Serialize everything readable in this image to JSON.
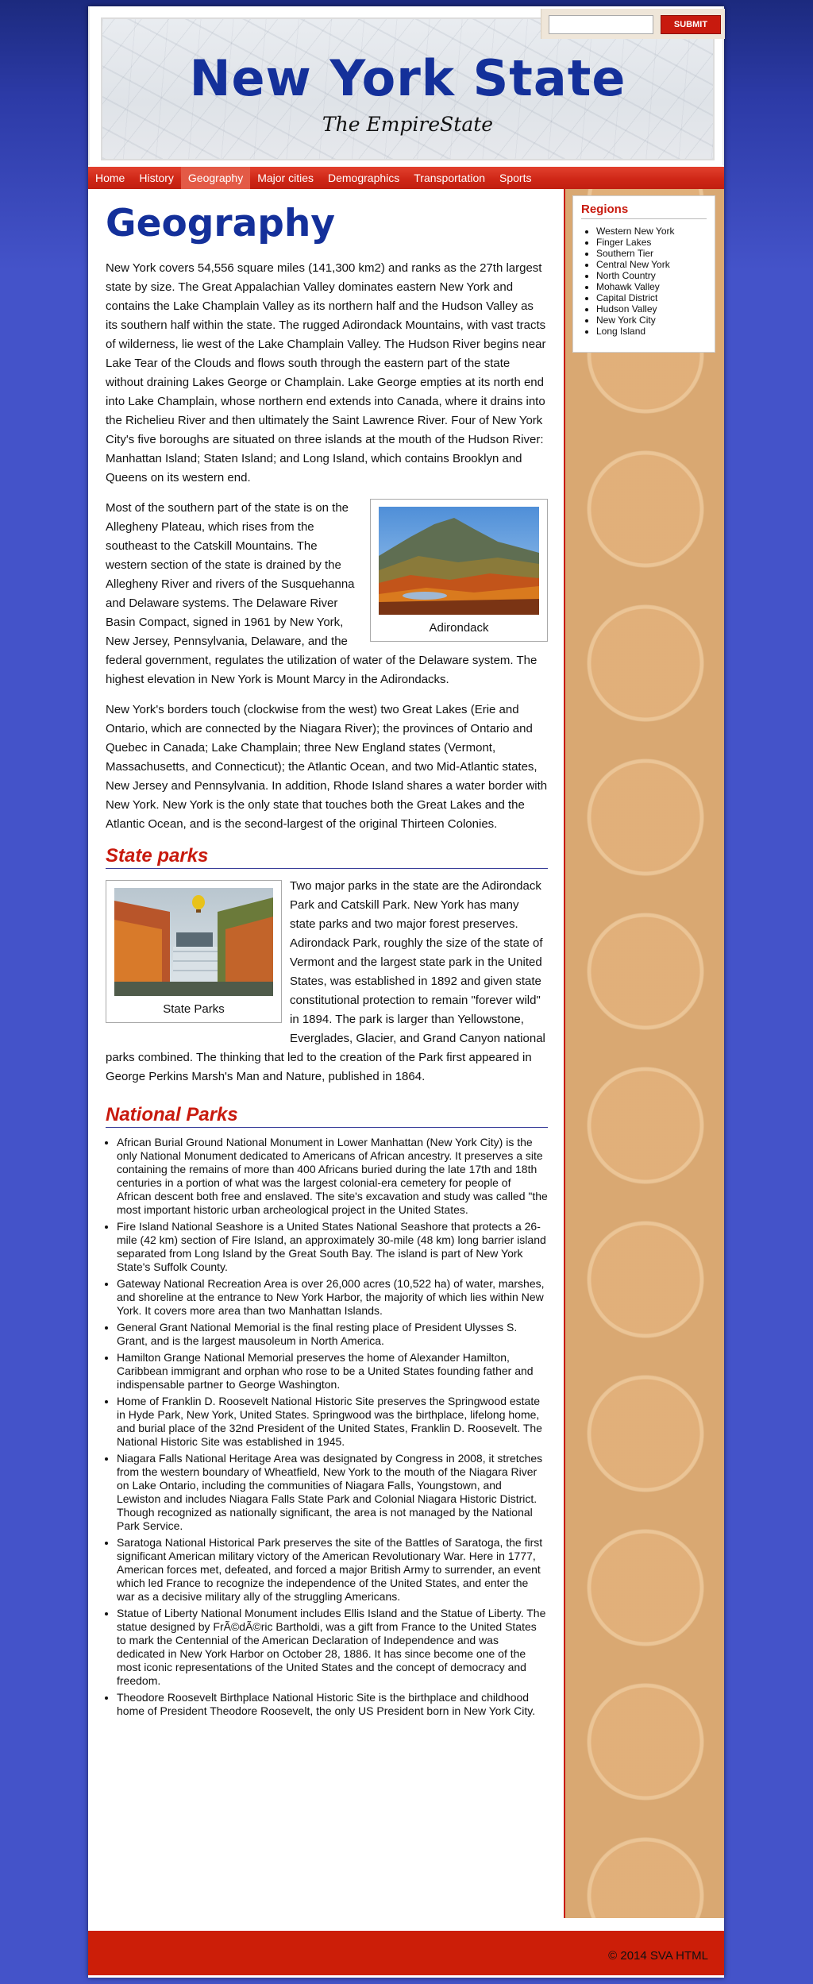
{
  "header": {
    "title": "New York State",
    "tagline": "The EmpireState",
    "search": {
      "value": "",
      "placeholder": "",
      "submit_label": "SUBMIT"
    }
  },
  "nav": {
    "items": [
      {
        "label": "Home"
      },
      {
        "label": "History"
      },
      {
        "label": "Geography"
      },
      {
        "label": "Major cities"
      },
      {
        "label": "Demographics"
      },
      {
        "label": "Transportation"
      },
      {
        "label": "Sports"
      }
    ],
    "active": "Geography"
  },
  "main": {
    "heading": "Geography",
    "paragraphs": [
      "New York covers 54,556 square miles (141,300 km2) and ranks as the 27th largest state by size. The Great Appalachian Valley dominates eastern New York and contains the Lake Champlain Valley as its northern half and the Hudson Valley as its southern half within the state. The rugged Adirondack Mountains, with vast tracts of wilderness, lie west of the Lake Champlain Valley. The Hudson River begins near Lake Tear of the Clouds and flows south through the eastern part of the state without draining Lakes George or Champlain. Lake George empties at its north end into Lake Champlain, whose northern end extends into Canada, where it drains into the Richelieu River and then ultimately the Saint Lawrence River. Four of New York City's five boroughs are situated on three islands at the mouth of the Hudson River: Manhattan Island; Staten Island; and Long Island, which contains Brooklyn and Queens on its western end.",
      "Most of the southern part of the state is on the Allegheny Plateau, which rises from the southeast to the Catskill Mountains. The western section of the state is drained by the Allegheny River and rivers of the Susquehanna and Delaware systems. The Delaware River Basin Compact, signed in 1961 by New York, New Jersey, Pennsylvania, Delaware, and the federal government, regulates the utilization of water of the Delaware system. The highest elevation in New York is Mount Marcy in the Adirondacks.",
      "New York's borders touch (clockwise from the west) two Great Lakes (Erie and Ontario, which are connected by the Niagara River); the provinces of Ontario and Quebec in Canada; Lake Champlain; three New England states (Vermont, Massachusetts, and Connecticut); the Atlantic Ocean, and two Mid-Atlantic states, New Jersey and Pennsylvania. In addition, Rhode Island shares a water border with New York. New York is the only state that touches both the Great Lakes and the Atlantic Ocean, and is the second-largest of the original Thirteen Colonies."
    ],
    "figure_adirondack": {
      "caption": "Adirondack"
    },
    "state_parks": {
      "heading": "State parks",
      "figure_caption": "State Parks",
      "text": "Two major parks in the state are the Adirondack Park and Catskill Park. New York has many state parks and two major forest preserves. Adirondack Park, roughly the size of the state of Vermont and the largest state park in the United States, was established in 1892 and given state constitutional protection to remain \"forever wild\" in 1894. The park is larger than Yellowstone, Everglades, Glacier, and Grand Canyon national parks combined. The thinking that led to the creation of the Park first appeared in George Perkins Marsh's Man and Nature, published in 1864."
    },
    "national_parks": {
      "heading": "National Parks",
      "items": [
        "African Burial Ground National Monument in Lower Manhattan (New York City) is the only National Monument dedicated to Americans of African ancestry. It preserves a site containing the remains of more than 400 Africans buried during the late 17th and 18th centuries in a portion of what was the largest colonial-era cemetery for people of African descent both free and enslaved. The site's excavation and study was called \"the most important historic urban archeological project in the United States.",
        "Fire Island National Seashore is a United States National Seashore that protects a 26-mile (42 km) section of Fire Island, an approximately 30-mile (48 km) long barrier island separated from Long Island by the Great South Bay. The island is part of New York State's Suffolk County.",
        "Gateway National Recreation Area is over 26,000 acres (10,522 ha) of water, marshes, and shoreline at the entrance to New York Harbor, the majority of which lies within New York. It covers more area than two Manhattan Islands.",
        "General Grant National Memorial is the final resting place of President Ulysses S. Grant, and is the largest mausoleum in North America.",
        "Hamilton Grange National Memorial preserves the home of Alexander Hamilton, Caribbean immigrant and orphan who rose to be a United States founding father and indispensable partner to George Washington.",
        "Home of Franklin D. Roosevelt National Historic Site preserves the Springwood estate in Hyde Park, New York, United States. Springwood was the birthplace, lifelong home, and burial place of the 32nd President of the United States, Franklin D. Roosevelt. The National Historic Site was established in 1945.",
        "Niagara Falls National Heritage Area was designated by Congress in 2008, it stretches from the western boundary of Wheatfield, New York to the mouth of the Niagara River on Lake Ontario, including the communities of Niagara Falls, Youngstown, and Lewiston and includes Niagara Falls State Park and Colonial Niagara Historic District. Though recognized as nationally significant, the area is not managed by the National Park Service.",
        "Saratoga National Historical Park preserves the site of the Battles of Saratoga, the first significant American military victory of the American Revolutionary War. Here in 1777, American forces met, defeated, and forced a major British Army to surrender, an event which led France to recognize the independence of the United States, and enter the war as a decisive military ally of the struggling Americans.",
        "Statue of Liberty National Monument includes Ellis Island and the Statue of Liberty. The statue designed by FrÃ©dÃ©ric Bartholdi, was a gift from France to the United States to mark the Centennial of the American Declaration of Independence and was dedicated in New York Harbor on October 28, 1886. It has since become one of the most iconic representations of the United States and the concept of democracy and freedom.",
        "Theodore Roosevelt Birthplace National Historic Site is the birthplace and childhood home of President Theodore Roosevelt, the only US President born in New York City."
      ]
    }
  },
  "sidebar": {
    "title": "Regions",
    "regions": [
      "Western New York",
      "Finger Lakes",
      "Southern Tier",
      "Central New York",
      "North Country",
      "Mohawk Valley",
      "Capital District",
      "Hudson Valley",
      "New York City",
      "Long Island"
    ]
  },
  "footer": {
    "text": "© 2014 SVA HTML"
  },
  "colors": {
    "title_blue": "#14309a",
    "accent_red": "#c81a0e",
    "nav_red": "#cf2717",
    "sidebar_tan": "#d9a872",
    "background_blue": "#4453c9"
  }
}
